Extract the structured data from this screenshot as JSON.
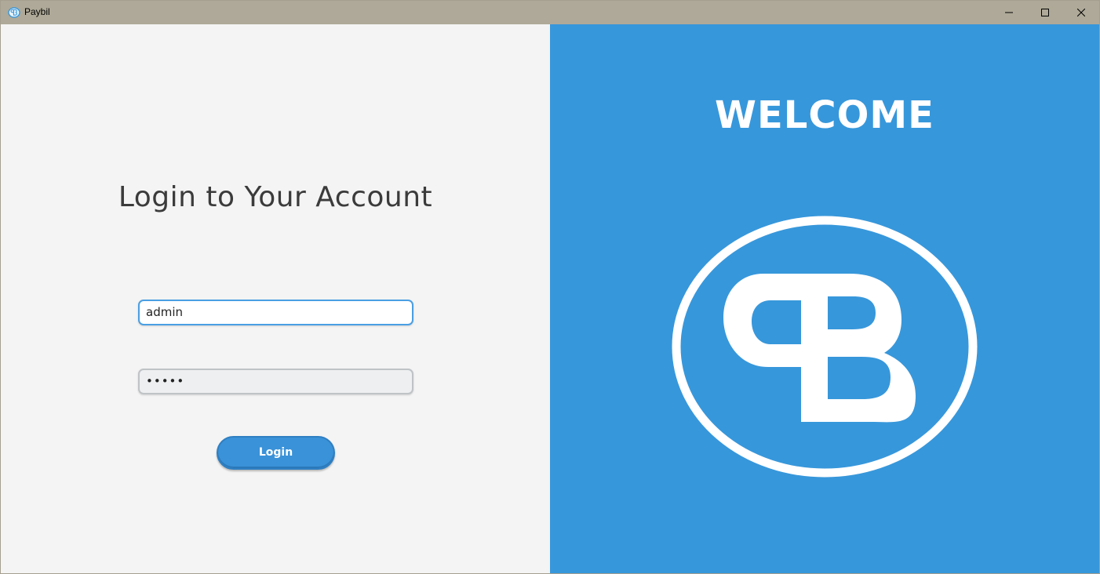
{
  "window": {
    "title": "Paybil"
  },
  "login": {
    "heading": "Login to Your Account",
    "username_value": "admin",
    "password_value": "•••••",
    "button_label": "Login"
  },
  "welcome": {
    "heading": "WELCOME"
  },
  "icons": {
    "app": "paybil-logo-icon",
    "minimize": "minimize-icon",
    "maximize": "maximize-icon",
    "close": "close-icon"
  },
  "colors": {
    "titlebar": "#aea998",
    "left_background": "#f4f4f4",
    "right_background": "#3797db",
    "accent": "#3a92d8",
    "logo": "#ffffff"
  }
}
